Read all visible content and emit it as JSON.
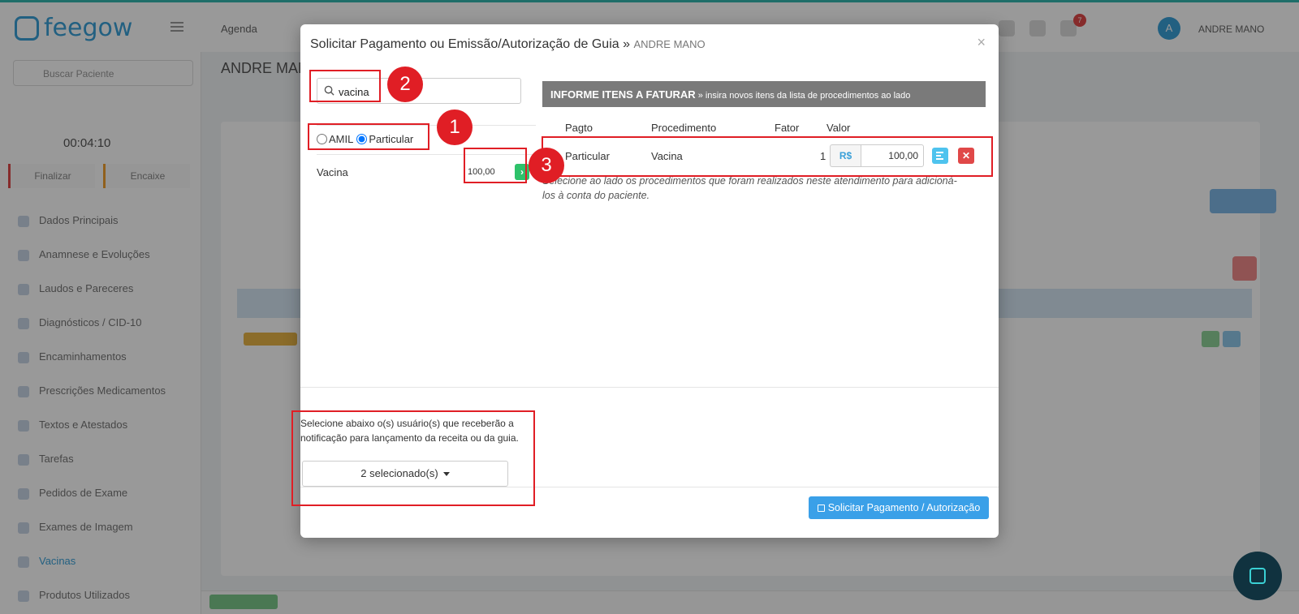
{
  "app": {
    "logo_text": "feegow",
    "top_menu": "Agenda",
    "notif_count": "7",
    "user_initial": "A",
    "user_name": "ANDRE MANO",
    "patient_header": "ANDRE MANO"
  },
  "sidebar": {
    "search_placeholder": "Buscar Paciente",
    "timer": "00:04:10",
    "action_left": "Finalizar",
    "action_right": "Encaixe",
    "items": [
      {
        "label": "Dados Principais"
      },
      {
        "label": "Anamnese e Evoluções"
      },
      {
        "label": "Laudos e Pareceres"
      },
      {
        "label": "Diagnósticos / CID-10"
      },
      {
        "label": "Encaminhamentos"
      },
      {
        "label": "Prescrições Medicamentos"
      },
      {
        "label": "Textos e Atestados"
      },
      {
        "label": "Tarefas"
      },
      {
        "label": "Pedidos de Exame"
      },
      {
        "label": "Exames de Imagem"
      },
      {
        "label": "Vacinas"
      },
      {
        "label": "Produtos Utilizados"
      }
    ]
  },
  "modal": {
    "title": "Solicitar Pagamento ou Emissão/Autorização de Guia »",
    "title_sub": "ANDRE MANO",
    "close": "×",
    "search_value": "vacina",
    "radio_options": [
      {
        "label": "AMIL",
        "checked": false
      },
      {
        "label": "Particular",
        "checked": true
      }
    ],
    "procedure": {
      "name": "Vacina",
      "price": "100,00",
      "add_icon": "›"
    },
    "right_header_title": "INFORME ITENS A FATURAR",
    "right_header_sub": "» insira novos itens da lista de procedimentos ao lado",
    "columns": {
      "pagto": "Pagto",
      "procedimento": "Procedimento",
      "fator": "Fator",
      "valor": "Valor"
    },
    "item_row": {
      "pagto": "Particular",
      "procedimento": "Vacina",
      "fator": "1",
      "currency": "R$",
      "valor": "100,00",
      "delete_icon": "✕"
    },
    "help_text": "Selecione ao lado os procedimentos que foram realizados neste atendimento para adicioná-los à conta do paciente.",
    "notify_text": "Selecione abaixo o(s) usuário(s) que receberão a notificação para lançamento da receita ou da guia.",
    "selected_users": "2 selecionado(s)",
    "submit_label": "Solicitar Pagamento / Autorização"
  },
  "annotations": {
    "one": "1",
    "two": "2",
    "three": "3",
    "color": "#e01e25"
  },
  "icons": [
    "search-icon",
    "chevron-right-icon",
    "description-icon",
    "close-icon",
    "save-icon",
    "caret-down-icon",
    "chat-icon"
  ]
}
